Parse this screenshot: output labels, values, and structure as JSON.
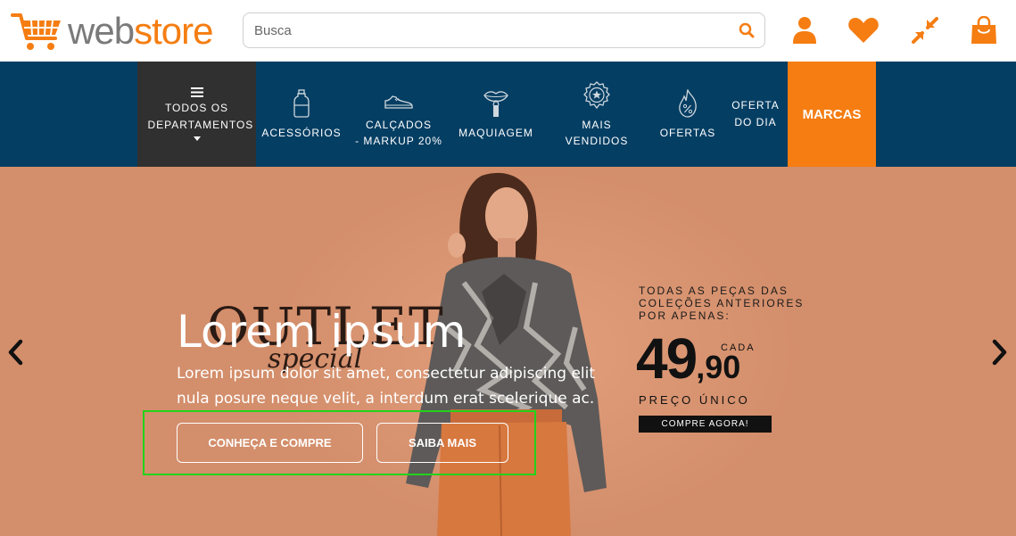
{
  "header": {
    "logo": {
      "part1": "web",
      "part2": "store"
    },
    "search": {
      "placeholder": "Busca",
      "value": ""
    },
    "icons": [
      "search-icon",
      "user-icon",
      "heart-icon",
      "compress-icon",
      "shopping-bag-icon"
    ]
  },
  "nav": {
    "departments_label": "TODOS OS DEPARTAMENTOS",
    "items": [
      {
        "label": "ACESSÓRIOS",
        "icon": "bottle-icon"
      },
      {
        "label": "CALÇADOS - MARKUP 20%",
        "line1": "CALÇADOS",
        "line2": "- MARKUP 20%",
        "icon": "sneaker-icon"
      },
      {
        "label": "MAQUIAGEM",
        "icon": "lipstick-icon"
      },
      {
        "label": "MAIS VENDIDOS",
        "icon": "badge-star-icon"
      },
      {
        "label": "OFERTAS",
        "icon": "fire-percent-icon"
      }
    ],
    "oferta_dia": {
      "line1": "OFERTA",
      "line2": "DO DIA"
    },
    "marcas": "MARCAS"
  },
  "hero": {
    "outlet_word": "OUTLET",
    "outlet_special": "special",
    "title": "Lorem ipsum",
    "text": "Lorem ipsum dolor sit amet, consectetur adipiscing elit nula posure neque velit, a interdum erat scelerique ac.",
    "button_primary": "CONHEÇA E COMPRE",
    "button_secondary": "SAIBA MAIS",
    "promo": {
      "line1": "TODAS AS PEÇAS DAS",
      "line2": "COLEÇÕES ANTERIORES",
      "line3": "POR APENAS:",
      "price_int": "49",
      "price_cents": ",90",
      "cada": "CADA",
      "unico": "PREÇO ÚNICO",
      "cta": "COMPRE AGORA!"
    }
  },
  "colors": {
    "brand_orange": "#f57d12",
    "nav_blue": "#053e63",
    "dept_dark": "#303030",
    "hero_bg": "#d38e6b",
    "highlight_green": "#22d31a"
  }
}
